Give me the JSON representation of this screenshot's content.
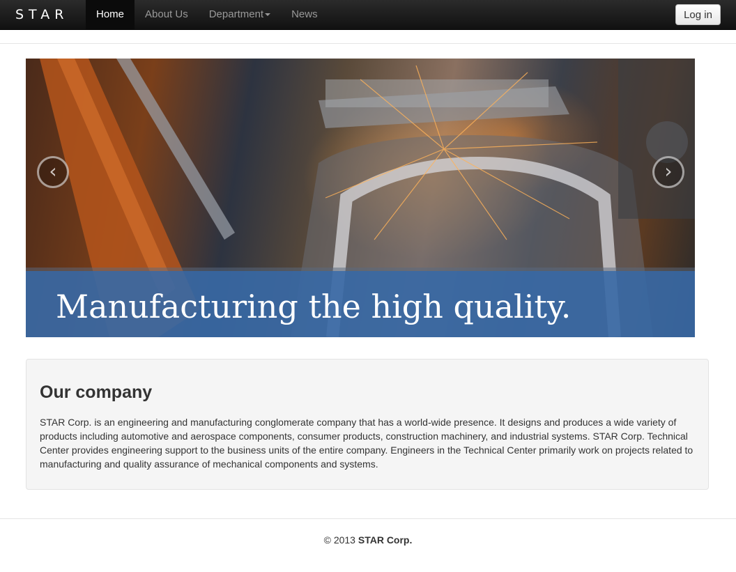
{
  "navbar": {
    "brand": "STAR",
    "items": [
      {
        "label": "Home",
        "active": true
      },
      {
        "label": "About Us",
        "active": false
      },
      {
        "label": "Department",
        "active": false,
        "dropdown": true
      },
      {
        "label": "News",
        "active": false
      }
    ],
    "login_label": "Log in"
  },
  "carousel": {
    "caption": "Manufacturing the high quality.",
    "prev_icon": "chevron-left-icon",
    "next_icon": "chevron-right-icon",
    "prev_glyph": "‹",
    "next_glyph": "›"
  },
  "company": {
    "heading": "Our company",
    "body": "STAR Corp. is an engineering and manufacturing conglomerate company that has a world-wide presence. It designs and produces a wide variety of products including automotive and aerospace components, consumer products, construction machinery, and industrial systems. STAR Corp. Technical Center provides engineering support to the business units of the entire company. Engineers in the Technical Center primarily work on projects related to manufacturing and quality assurance of mechanical components and systems."
  },
  "footer": {
    "copyright": "© 2013",
    "company": "STAR Corp."
  },
  "colors": {
    "navbar": "#1b1b1b",
    "caption_band": "#3469aa",
    "well_bg": "#f5f5f5"
  }
}
